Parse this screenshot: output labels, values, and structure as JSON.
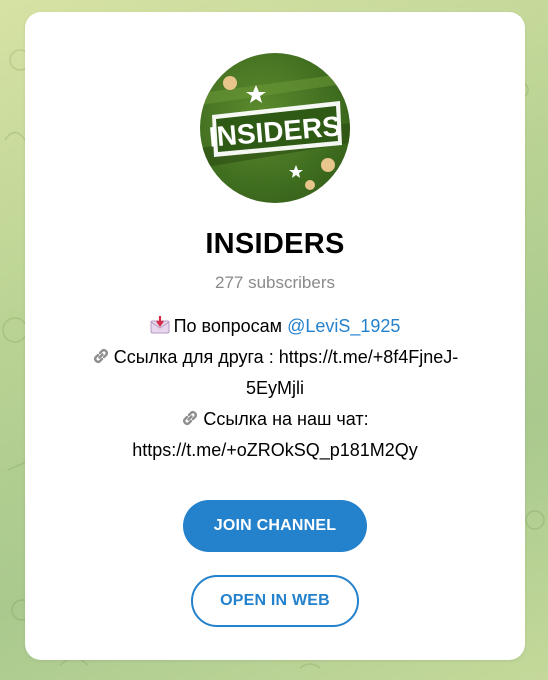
{
  "channel": {
    "avatar_text": "INSIDERS",
    "title": "INSIDERS",
    "subscribers": "277 subscribers"
  },
  "description": {
    "line1_text": "По вопросам",
    "line1_link": "@LeviS_1925",
    "line2": "Ссылка для друга : https://t.me/+8f4FjneJ-",
    "line3": "5EyMjli",
    "line4": "Ссылка на наш чат:",
    "line5": "https://t.me/+oZROkSQ_p181M2Qy",
    "icons": [
      "envelope-download-icon",
      "link-icon",
      "link-icon"
    ]
  },
  "actions": {
    "join_label": "JOIN CHANNEL",
    "web_label": "OPEN IN WEB"
  },
  "colors": {
    "accent": "#2481cc",
    "background": "#b8d293"
  }
}
